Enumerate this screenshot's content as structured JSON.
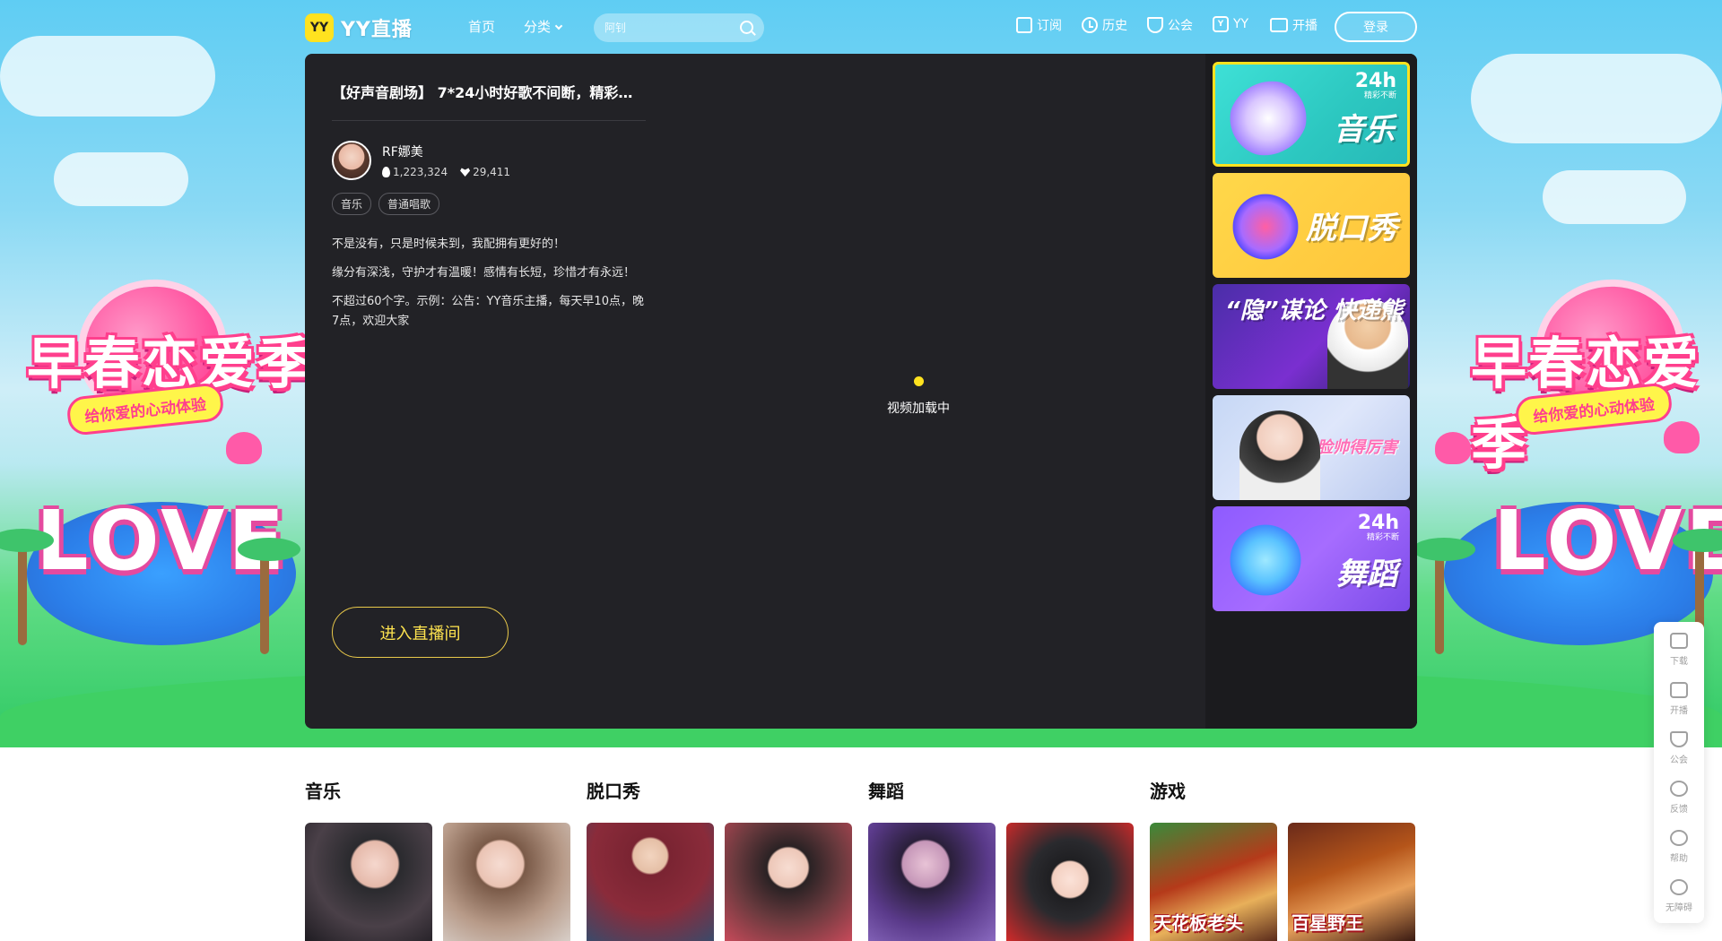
{
  "nav": {
    "logo_badge": "YY",
    "logo_text": "YY直播",
    "home": "首页",
    "category": "分类",
    "search_placeholder": "阿钊",
    "subscribe": "订阅",
    "history": "历史",
    "guild": "公会",
    "yy": "YY",
    "broadcast": "开播",
    "login": "登录"
  },
  "room": {
    "title": "【好声音剧场】 7*24小时好歌不间断，精彩不...",
    "streamer_name": "RF娜美",
    "heat": "1,223,324",
    "likes": "29,411",
    "tags": [
      "音乐",
      "普通唱歌"
    ],
    "desc": [
      "不是没有，只是时候未到，我配拥有更好的！",
      "缘分有深浅，守护才有温暖！感情有长短，珍惜才有永远！",
      "不超过60个字。示例：公告：YY音乐主播，每天早10点，晚7点，欢迎大家"
    ],
    "enter_label": "进入直播间",
    "loading_text": "视频加载中"
  },
  "rail": [
    {
      "title": "音乐",
      "badge": "24h",
      "badge_sub": "精彩不断"
    },
    {
      "title": "脱口秀"
    },
    {
      "title": "“隐”谋论 快递熊"
    },
    {
      "title": "活力女神 脸帅得厉害"
    },
    {
      "title": "舞蹈",
      "badge": "24h",
      "badge_sub": "精彩不断"
    }
  ],
  "background": {
    "spring_title": "早春恋爱季",
    "spring_sub": "给你爱的心动体验",
    "love": "LOVE"
  },
  "sections": [
    {
      "title": "音乐"
    },
    {
      "title": "脱口秀"
    },
    {
      "title": "舞蹈"
    },
    {
      "title": "游戏",
      "thumbs": [
        "天花板老头",
        "百星野王"
      ]
    }
  ],
  "float": [
    "下载",
    "开播",
    "公会",
    "反馈",
    "帮助",
    "无障碍"
  ],
  "colors": {
    "accent": "#ffe21f",
    "panel": "#222226",
    "rail": "#1b1b1e"
  }
}
